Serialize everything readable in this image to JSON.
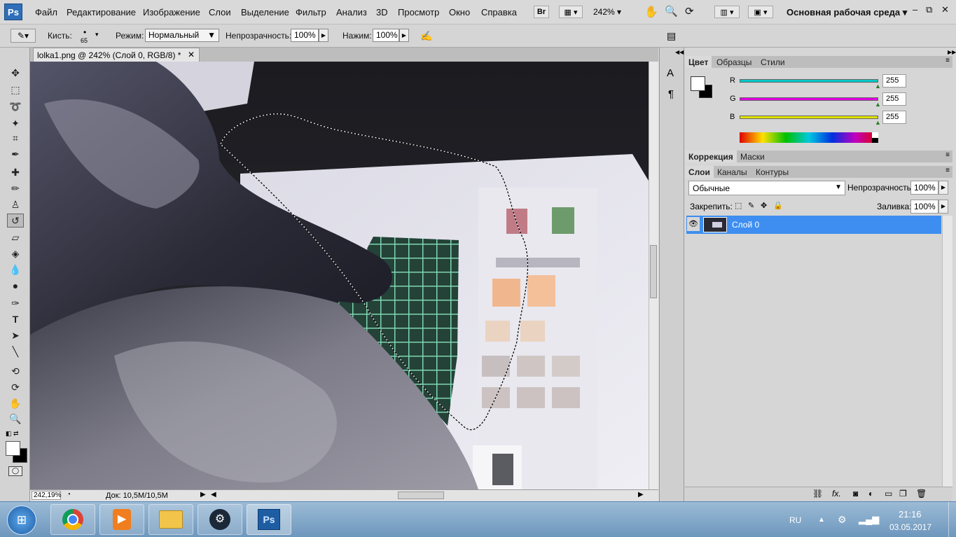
{
  "menubar": {
    "app_icon": "Ps",
    "items": [
      "Файл",
      "Редактирование",
      "Изображение",
      "Слои",
      "Выделение",
      "Фильтр",
      "Анализ",
      "3D",
      "Просмотр",
      "Окно",
      "Справка"
    ],
    "bridge": "Br",
    "zoom": "242%",
    "workspace": "Основная рабочая среда"
  },
  "options": {
    "brush_label": "Кисть:",
    "brush_size": "65",
    "mode_label": "Режим:",
    "mode_value": "Нормальный",
    "opacity_label": "Непрозрачность:",
    "opacity_value": "100%",
    "pressure_label": "Нажим:",
    "pressure_value": "100%"
  },
  "document": {
    "tab_title": "lolka1.png @ 242% (Слой 0, RGB/8) *",
    "zoom": "242,19%",
    "doc_size": "Док: 10,5M/10,5M"
  },
  "color_panel": {
    "tabs": [
      "Цвет",
      "Образцы",
      "Стили"
    ],
    "channels": [
      {
        "name": "R",
        "value": "255",
        "color": "#00c8c8"
      },
      {
        "name": "G",
        "value": "255",
        "color": "#e000e0"
      },
      {
        "name": "B",
        "value": "255",
        "color": "#e0e000"
      }
    ]
  },
  "adjust_panel": {
    "tabs": [
      "Коррекция",
      "Маски"
    ]
  },
  "layers_panel": {
    "tabs": [
      "Слои",
      "Каналы",
      "Контуры"
    ],
    "blend_mode": "Обычные",
    "opacity_label": "Непрозрачность:",
    "opacity_value": "100%",
    "lock_label": "Закрепить:",
    "fill_label": "Заливка:",
    "fill_value": "100%",
    "layers": [
      {
        "name": "Слой 0",
        "selected": true
      }
    ]
  },
  "taskbar": {
    "lang": "RU",
    "time": "21:16",
    "date": "03.05.2017"
  }
}
